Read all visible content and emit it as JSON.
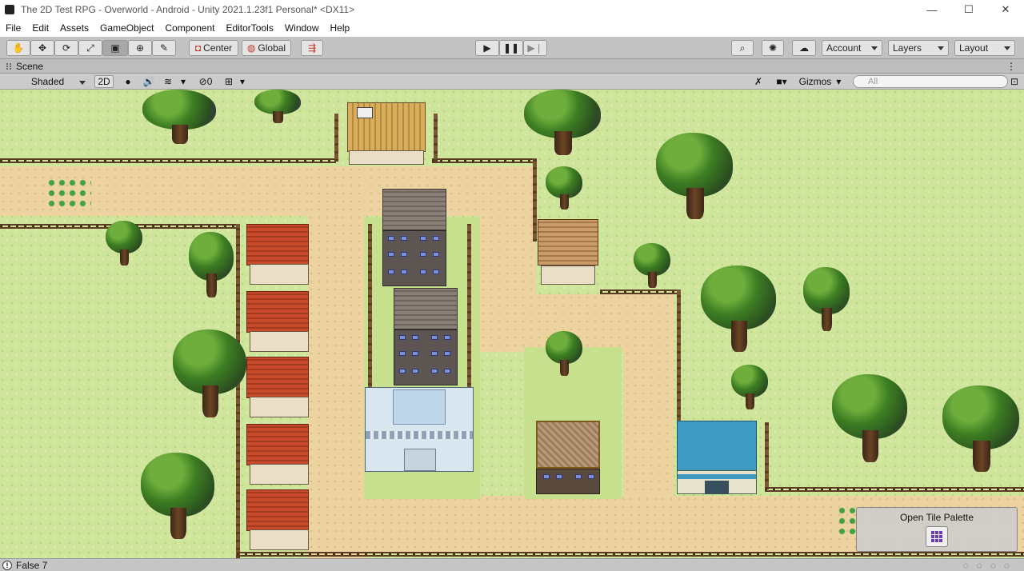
{
  "window": {
    "title": "The 2D Test RPG - Overworld - Android - Unity 2021.1.23f1 Personal* <DX11>",
    "minimize": "—",
    "maximize": "☐",
    "close": "✕"
  },
  "menu": [
    "File",
    "Edit",
    "Assets",
    "GameObject",
    "Component",
    "EditorTools",
    "Window",
    "Help"
  ],
  "toolbar": {
    "pivot_mode": "Center",
    "pivot_rotation": "Global",
    "account": "Account",
    "layers": "Layers",
    "layout": "Layout"
  },
  "scene_tab": {
    "label": "Scene"
  },
  "scene_toolbar": {
    "draw_mode": "Shaded",
    "mode_2d": "2D",
    "hidden_count": "0",
    "gizmos": "Gizmos",
    "search_placeholder": "All"
  },
  "tile_palette": {
    "label": "Open Tile Palette"
  },
  "status": {
    "message": "False 7"
  },
  "colors": {
    "grass": "#cfe59b",
    "path": "#ecd3a0",
    "toolbar": "#c2c2c2",
    "accent_palette": "#6a3db8"
  }
}
